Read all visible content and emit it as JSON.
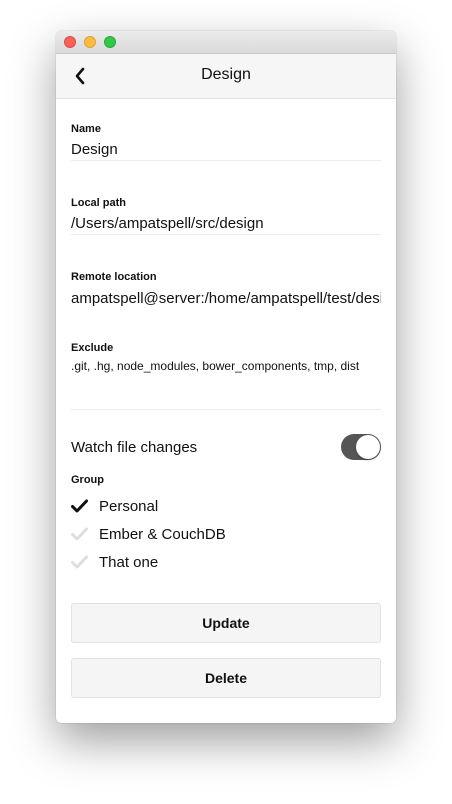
{
  "header": {
    "title": "Design"
  },
  "fields": {
    "name": {
      "label": "Name",
      "value": "Design"
    },
    "local_path": {
      "label": "Local path",
      "value": "/Users/ampatspell/src/design"
    },
    "remote_location": {
      "label": "Remote location",
      "value": "ampatspell@server:/home/ampatspell/test/design"
    },
    "exclude": {
      "label": "Exclude",
      "value": ".git, .hg, node_modules, bower_components, tmp, dist"
    }
  },
  "watch": {
    "label": "Watch file changes",
    "enabled": true
  },
  "group": {
    "label": "Group",
    "items": [
      {
        "label": "Personal",
        "selected": true
      },
      {
        "label": "Ember & CouchDB",
        "selected": false
      },
      {
        "label": "That one",
        "selected": false
      }
    ]
  },
  "buttons": {
    "update": "Update",
    "delete": "Delete"
  },
  "icons": {
    "back": "chevron-left-icon",
    "check": "checkmark-icon"
  },
  "colors": {
    "toggle_on": "#555555",
    "check_selected": "#111111",
    "check_unselected": "#dddddd"
  }
}
